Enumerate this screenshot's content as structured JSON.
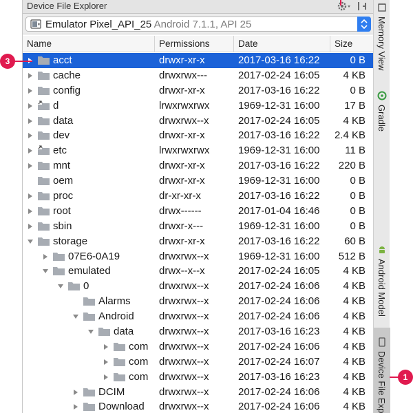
{
  "panel": {
    "title": "Device File Explorer",
    "device": {
      "name": "Emulator Pixel_API_25",
      "version": "Android 7.1.1, API 25"
    }
  },
  "columns": {
    "name": "Name",
    "permissions": "Permissions",
    "date": "Date",
    "size": "Size"
  },
  "rows": [
    {
      "name": "acct",
      "perm": "drwxr-xr-x",
      "date": "2017-03-16 16:22",
      "size": "0 B",
      "depth": 0,
      "arrow": "right",
      "icon": "folder",
      "selected": true
    },
    {
      "name": "cache",
      "perm": "drwxrwx---",
      "date": "2017-02-24 16:05",
      "size": "4 KB",
      "depth": 0,
      "arrow": "right",
      "icon": "folder"
    },
    {
      "name": "config",
      "perm": "drwxr-xr-x",
      "date": "2017-03-16 16:22",
      "size": "0 B",
      "depth": 0,
      "arrow": "right",
      "icon": "folder"
    },
    {
      "name": "d",
      "perm": "lrwxrwxrwx",
      "date": "1969-12-31 16:00",
      "size": "17 B",
      "depth": 0,
      "arrow": "right",
      "icon": "link"
    },
    {
      "name": "data",
      "perm": "drwxrwx--x",
      "date": "2017-02-24 16:05",
      "size": "4 KB",
      "depth": 0,
      "arrow": "right",
      "icon": "folder"
    },
    {
      "name": "dev",
      "perm": "drwxr-xr-x",
      "date": "2017-03-16 16:22",
      "size": "2.4 KB",
      "depth": 0,
      "arrow": "right",
      "icon": "folder"
    },
    {
      "name": "etc",
      "perm": "lrwxrwxrwx",
      "date": "1969-12-31 16:00",
      "size": "11 B",
      "depth": 0,
      "arrow": "right",
      "icon": "link"
    },
    {
      "name": "mnt",
      "perm": "drwxr-xr-x",
      "date": "2017-03-16 16:22",
      "size": "220 B",
      "depth": 0,
      "arrow": "right",
      "icon": "folder"
    },
    {
      "name": "oem",
      "perm": "drwxr-xr-x",
      "date": "1969-12-31 16:00",
      "size": "0 B",
      "depth": 0,
      "arrow": "none",
      "icon": "folder"
    },
    {
      "name": "proc",
      "perm": "dr-xr-xr-x",
      "date": "2017-03-16 16:22",
      "size": "0 B",
      "depth": 0,
      "arrow": "right",
      "icon": "folder"
    },
    {
      "name": "root",
      "perm": "drwx------",
      "date": "2017-01-04 16:46",
      "size": "0 B",
      "depth": 0,
      "arrow": "right",
      "icon": "folder"
    },
    {
      "name": "sbin",
      "perm": "drwxr-x---",
      "date": "1969-12-31 16:00",
      "size": "0 B",
      "depth": 0,
      "arrow": "right",
      "icon": "folder"
    },
    {
      "name": "storage",
      "perm": "drwxr-xr-x",
      "date": "2017-03-16 16:22",
      "size": "60 B",
      "depth": 0,
      "arrow": "down",
      "icon": "folder"
    },
    {
      "name": "07E6-0A19",
      "perm": "drwxrwx--x",
      "date": "1969-12-31 16:00",
      "size": "512 B",
      "depth": 1,
      "arrow": "right",
      "icon": "folder"
    },
    {
      "name": "emulated",
      "perm": "drwx--x--x",
      "date": "2017-02-24 16:05",
      "size": "4 KB",
      "depth": 1,
      "arrow": "down",
      "icon": "folder"
    },
    {
      "name": "0",
      "perm": "drwxrwx--x",
      "date": "2017-02-24 16:06",
      "size": "4 KB",
      "depth": 2,
      "arrow": "down",
      "icon": "folder"
    },
    {
      "name": "Alarms",
      "perm": "drwxrwx--x",
      "date": "2017-02-24 16:06",
      "size": "4 KB",
      "depth": 3,
      "arrow": "none",
      "icon": "folder"
    },
    {
      "name": "Android",
      "perm": "drwxrwx--x",
      "date": "2017-02-24 16:06",
      "size": "4 KB",
      "depth": 3,
      "arrow": "down",
      "icon": "folder"
    },
    {
      "name": "data",
      "perm": "drwxrwx--x",
      "date": "2017-03-16 16:23",
      "size": "4 KB",
      "depth": 4,
      "arrow": "down",
      "icon": "folder"
    },
    {
      "name": "com",
      "perm": "drwxrwx--x",
      "date": "2017-02-24 16:06",
      "size": "4 KB",
      "depth": 5,
      "arrow": "right",
      "icon": "folder"
    },
    {
      "name": "com",
      "perm": "drwxrwx--x",
      "date": "2017-02-24 16:07",
      "size": "4 KB",
      "depth": 5,
      "arrow": "right",
      "icon": "folder"
    },
    {
      "name": "com",
      "perm": "drwxrwx--x",
      "date": "2017-03-16 16:23",
      "size": "4 KB",
      "depth": 5,
      "arrow": "right",
      "icon": "folder"
    },
    {
      "name": "DCIM",
      "perm": "drwxrwx--x",
      "date": "2017-02-24 16:06",
      "size": "4 KB",
      "depth": 3,
      "arrow": "right",
      "icon": "folder"
    },
    {
      "name": "Download",
      "perm": "drwxrwx--x",
      "date": "2017-02-24 16:06",
      "size": "4 KB",
      "depth": 3,
      "arrow": "right",
      "icon": "folder"
    }
  ],
  "side_tabs": {
    "memory": "Memory View",
    "gradle": "Gradle",
    "android_model": "Android Model",
    "dfe": "Device File Exp"
  },
  "callouts": {
    "c1": "1",
    "c3": "3"
  },
  "colors": {
    "selection": "#1b62d8",
    "callout": "#e01a4f",
    "folder": "#a7acb3",
    "select_accent": "#2f7ef0"
  },
  "icons": {
    "settings": "gear-icon",
    "hide": "hide-panel-icon",
    "device": "phone-icon",
    "folder": "folder-icon",
    "link": "symlink-folder-icon"
  }
}
